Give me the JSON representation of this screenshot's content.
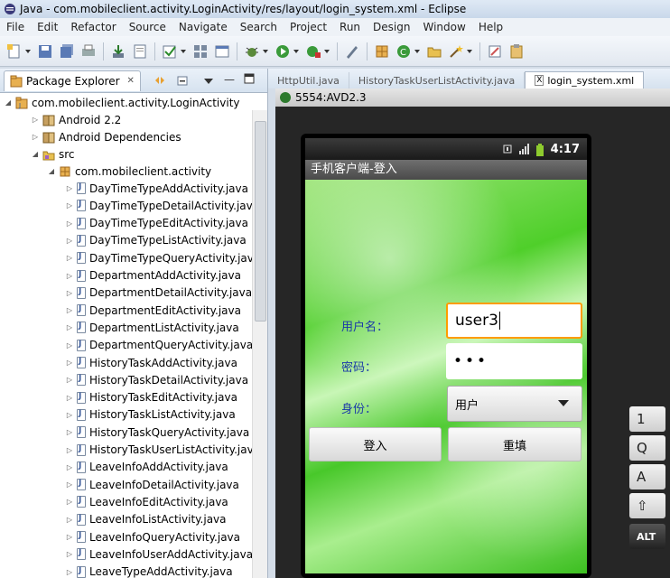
{
  "window": {
    "title": "Java - com.mobileclient.activity.LoginActivity/res/layout/login_system.xml - Eclipse"
  },
  "menu": [
    "File",
    "Edit",
    "Refactor",
    "Source",
    "Navigate",
    "Search",
    "Project",
    "Run",
    "Design",
    "Window",
    "Help"
  ],
  "package_explorer": {
    "tab_label": "Package Explorer",
    "project": "com.mobileclient.activity.LoginActivity",
    "android_version": "Android 2.2",
    "dependencies": "Android Dependencies",
    "src": "src",
    "package": "com.mobileclient.activity",
    "files": [
      "DayTimeTypeAddActivity.java",
      "DayTimeTypeDetailActivity.jav",
      "DayTimeTypeEditActivity.java",
      "DayTimeTypeListActivity.java",
      "DayTimeTypeQueryActivity.jav",
      "DepartmentAddActivity.java",
      "DepartmentDetailActivity.java",
      "DepartmentEditActivity.java",
      "DepartmentListActivity.java",
      "DepartmentQueryActivity.java",
      "HistoryTaskAddActivity.java",
      "HistoryTaskDetailActivity.java",
      "HistoryTaskEditActivity.java",
      "HistoryTaskListActivity.java",
      "HistoryTaskQueryActivity.java",
      "HistoryTaskUserListActivity.jav",
      "LeaveInfoAddActivity.java",
      "LeaveInfoDetailActivity.java",
      "LeaveInfoEditActivity.java",
      "LeaveInfoListActivity.java",
      "LeaveInfoQueryActivity.java",
      "LeaveInfoUserAddActivity.java",
      "LeaveTypeAddActivity.java"
    ]
  },
  "editor_tabs": [
    "HttpUtil.java",
    "HistoryTaskUserListActivity.java",
    "login_system.xml"
  ],
  "emulator": {
    "title": "5554:AVD2.3",
    "clock": "4:17",
    "app_title": "手机客户端-登入",
    "username_label": "用户名：",
    "username_value": "user3",
    "password_label": "密码：",
    "password_value": "•••",
    "role_label": "身份：",
    "role_value": "用户",
    "login_button": "登入",
    "reset_button": "重填",
    "keys": [
      "1",
      "Q",
      "A",
      "⇧",
      "ALT"
    ]
  }
}
